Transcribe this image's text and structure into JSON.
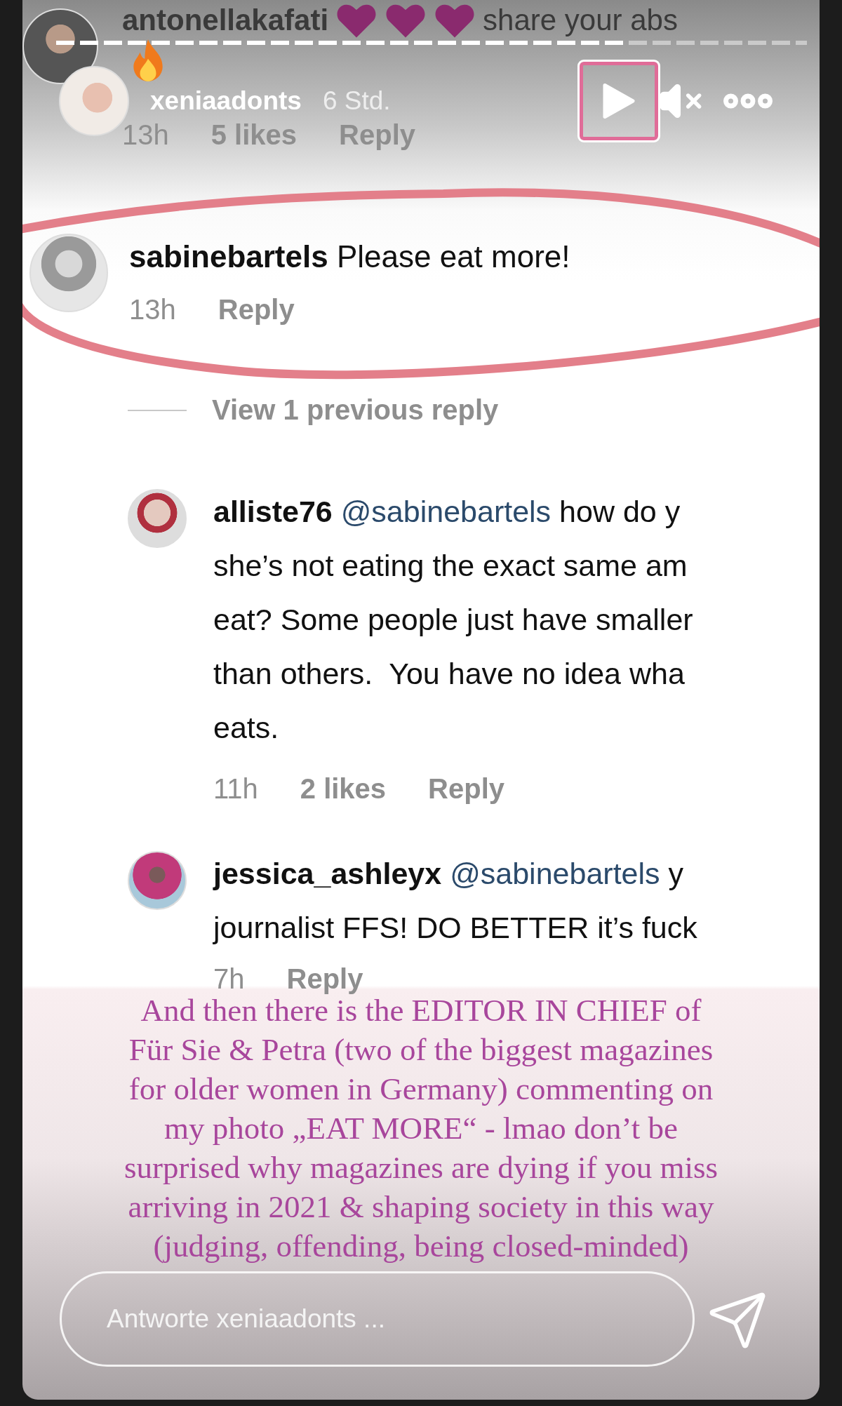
{
  "progress": {
    "level": 0.76
  },
  "header": {
    "username": "xeniaadonts",
    "time": "6 Std."
  },
  "top_comment": {
    "username": "antonellakafati",
    "text": "share your abs",
    "meta": {
      "time": "13h",
      "likes": "5 likes",
      "reply": "Reply"
    }
  },
  "comment": {
    "username": "sabinebartels",
    "text": "Please eat more!",
    "highlighted": true,
    "meta": {
      "time": "13h",
      "reply": "Reply"
    }
  },
  "view_replies": "View 1 previous reply",
  "replies": [
    {
      "username": "alliste76",
      "mention": "@sabinebartels",
      "lines": [
        "how do y",
        "she’s not eating the exact same am",
        "eat? Some people just have smaller",
        "than others.  You have no idea wha",
        "eats."
      ],
      "meta": {
        "time": "11h",
        "likes": "2 likes",
        "reply": "Reply"
      }
    },
    {
      "username": "jessica_ashleyx",
      "mention": "@sabinebartels",
      "lines": [
        "y",
        "journalist FFS! DO BETTER it’s fuck"
      ],
      "meta": {
        "time": "7h",
        "reply": "Reply"
      }
    }
  ],
  "caption": [
    "And then there is the EDITOR IN CHIEF of",
    "Für Sie & Petra (two of the biggest magazines",
    "for older women in Germany) commenting on",
    "my photo „EAT MORE“ - lmao don’t be",
    "surprised why magazines are dying if you miss",
    "arriving in 2021 & shaping society in this way",
    "(judging, offending, being closed-minded)"
  ],
  "reply_field": {
    "placeholder": "Antworte xeniaadonts ..."
  }
}
